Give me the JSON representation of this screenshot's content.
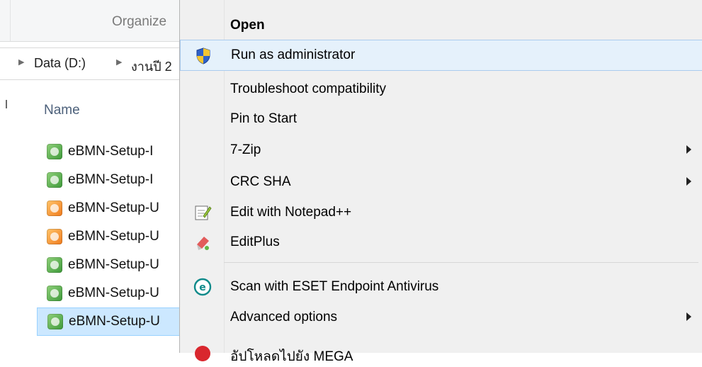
{
  "explorer": {
    "ribbon_group_label": "Organize",
    "breadcrumb": [
      {
        "label": "Data (D:)"
      },
      {
        "label": "งานปี 2"
      }
    ],
    "column_header": "Name",
    "files": [
      {
        "name": "eBMN-Setup-I",
        "icon": "app-icon-green",
        "selected": false
      },
      {
        "name": "eBMN-Setup-I",
        "icon": "app-icon-green",
        "selected": false
      },
      {
        "name": "eBMN-Setup-U",
        "icon": "app-icon-orange",
        "selected": false
      },
      {
        "name": "eBMN-Setup-U",
        "icon": "app-icon-orange",
        "selected": false
      },
      {
        "name": "eBMN-Setup-U",
        "icon": "app-icon-green",
        "selected": false
      },
      {
        "name": "eBMN-Setup-U",
        "icon": "app-icon-green",
        "selected": false
      },
      {
        "name": "eBMN-Setup-U",
        "icon": "app-icon-green",
        "selected": true
      }
    ]
  },
  "context_menu": {
    "items": [
      {
        "label": "Open",
        "bold": true,
        "icon": null,
        "submenu": false
      },
      {
        "label": "Run as administrator",
        "bold": false,
        "icon": "uac-shield-icon",
        "submenu": false,
        "highlighted": true
      },
      {
        "label": "Troubleshoot compatibility",
        "bold": false,
        "icon": null,
        "submenu": false
      },
      {
        "label": "Pin to Start",
        "bold": false,
        "icon": null,
        "submenu": false
      },
      {
        "label": "7-Zip",
        "bold": false,
        "icon": null,
        "submenu": true
      },
      {
        "label": "CRC SHA",
        "bold": false,
        "icon": null,
        "submenu": true
      },
      {
        "label": "Edit with Notepad++",
        "bold": false,
        "icon": "notepad-plus-plus-icon",
        "submenu": false
      },
      {
        "label": "EditPlus",
        "bold": false,
        "icon": "editplus-icon",
        "submenu": false
      },
      {
        "label": "Scan with ESET Endpoint Antivirus",
        "bold": false,
        "icon": "eset-icon",
        "submenu": false
      },
      {
        "label": "Advanced options",
        "bold": false,
        "icon": null,
        "submenu": true
      },
      {
        "label": "อัปโหลดไปยัง MEGA",
        "bold": false,
        "icon": "mega-icon",
        "submenu": false,
        "partial": true
      }
    ]
  },
  "colors": {
    "menu_background": "#f0f0f0",
    "highlight_background": "#e5f1fb",
    "highlight_border": "#aacbee",
    "selection_background": "#cce8ff"
  }
}
